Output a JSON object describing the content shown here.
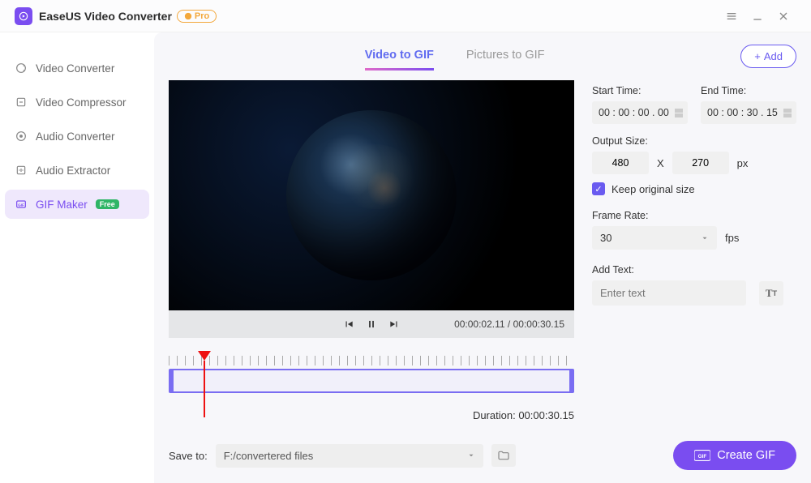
{
  "app": {
    "title": "EaseUS Video Converter",
    "badge": "Pro"
  },
  "sidebar": {
    "items": [
      {
        "label": "Video Converter"
      },
      {
        "label": "Video Compressor"
      },
      {
        "label": "Audio Converter"
      },
      {
        "label": "Audio Extractor"
      },
      {
        "label": "GIF Maker",
        "badge": "Free"
      }
    ]
  },
  "tabs": {
    "video": "Video to GIF",
    "pictures": "Pictures to GIF"
  },
  "add_btn": "Add",
  "player": {
    "current": "00:00:02.11",
    "total": "00:00:30.15"
  },
  "timeline": {
    "duration_label": "Duration:",
    "duration": "00:00:30.15"
  },
  "opts": {
    "start_label": "Start Time:",
    "start_value": "00 : 00 : 00 . 00",
    "end_label": "End Time:",
    "end_value": "00 : 00 : 30 . 15",
    "output_label": "Output Size:",
    "width": "480",
    "height": "270",
    "px": "px",
    "x": "X",
    "keep": "Keep original size",
    "fr_label": "Frame Rate:",
    "fr_value": "30",
    "fps": "fps",
    "add_text_label": "Add Text:",
    "add_text_ph": "Enter text"
  },
  "footer": {
    "save_label": "Save to:",
    "save_path": "F:/convertered files",
    "create": "Create GIF"
  }
}
